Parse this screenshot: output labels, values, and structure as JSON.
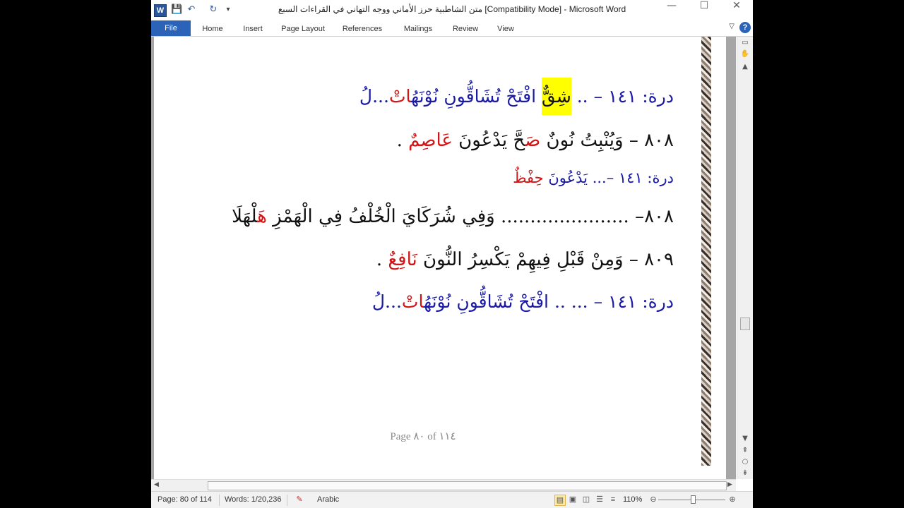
{
  "window": {
    "title": "متن الشاطبية حرز الأماني ووجه التهاني في القراءات السبع [Compatibility Mode]  -  Microsoft Word",
    "app_icon": "W",
    "controls": {
      "minimize": "—",
      "maximize": "☐",
      "close": "✕"
    }
  },
  "qat": {
    "save_icon": "💾",
    "undo_icon": "↶",
    "redo_icon": "↻",
    "customize_icon": "▾"
  },
  "ribbon": {
    "tabs": [
      "File",
      "Home",
      "Insert",
      "Page Layout",
      "References",
      "Mailings",
      "Review",
      "View"
    ],
    "help": "?",
    "collapse": "▽"
  },
  "document": {
    "lines": [
      {
        "prefix": "درة: ١٤١ – .. ",
        "highlighted": "شِقٌّ",
        "rest": " افْتَحْ تُشَاقُّونِ نُوْنَهُ",
        "red": "اتْ",
        "tail": "...لُ"
      },
      {
        "prefix": "٨٠٨ – وَيُنْبِتُ نُونٌ ",
        "red1": "صَ",
        "mid": "حَّ يَدْعُونَ ",
        "red2": "عَاصِمٌ",
        "tail": " ."
      },
      {
        "prefix": "درة: ١٤١ –... يَدْعُونَ ",
        "red": "حِفْظٌ",
        "tail": ""
      },
      {
        "prefix": "٨٠٨– ...................... وَفِي شُرَكَايَ الْخُلْفُ فِي الْهَمْزِ ",
        "red": "هَ",
        "tail": "لْهَلَا"
      },
      {
        "prefix": "٨٠٩ – وَمِنْ قَبْلِ فِيهِمْ يَكْسِرُ النُّونَ ",
        "red": "نَافِعٌ",
        "tail": " ."
      },
      {
        "prefix": "درة: ١٤١ – ... .. افْتَحْ تُشَاقُّونِ نُوْنَهُ",
        "red": "اتْ",
        "tail": "...لُ"
      }
    ],
    "footer": "Page ٨٠ of ١١٤"
  },
  "status": {
    "page": "Page: 80 of 114",
    "words": "Words: 1/20,236",
    "language": "Arabic",
    "zoom": "110%",
    "zoom_minus": "⊖",
    "zoom_plus": "⊕"
  },
  "colors": {
    "accent": "#2b63b8",
    "arabic_blue": "#1a1aa6",
    "arabic_red": "#d21414",
    "highlight": "#ffff00"
  }
}
